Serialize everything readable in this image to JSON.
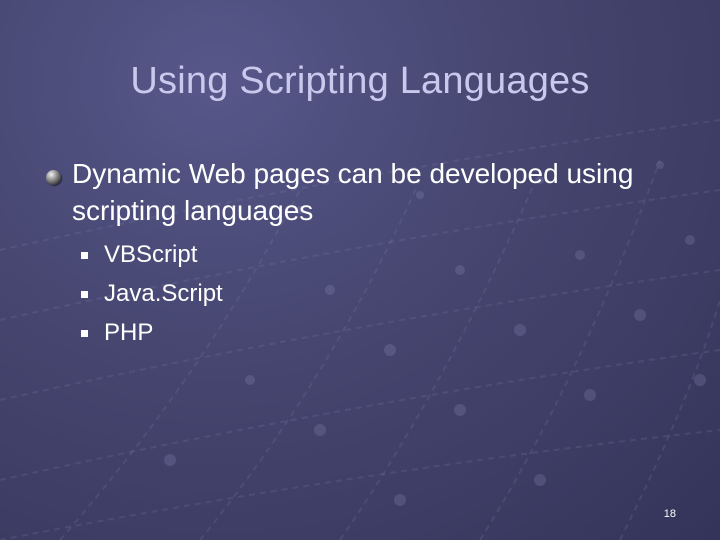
{
  "slide": {
    "title": "Using Scripting Languages",
    "main_bullet": "Dynamic Web pages can be developed using scripting languages",
    "sub_bullets": [
      "VBScript",
      "Java.Script",
      "PHP"
    ],
    "page_number": "18"
  },
  "colors": {
    "background": "#45456f",
    "title": "#c9c9ee",
    "body_text": "#ffffff"
  },
  "icons": {
    "main_bullet": "sphere-bullet-icon",
    "sub_bullet": "square-bullet-icon"
  }
}
